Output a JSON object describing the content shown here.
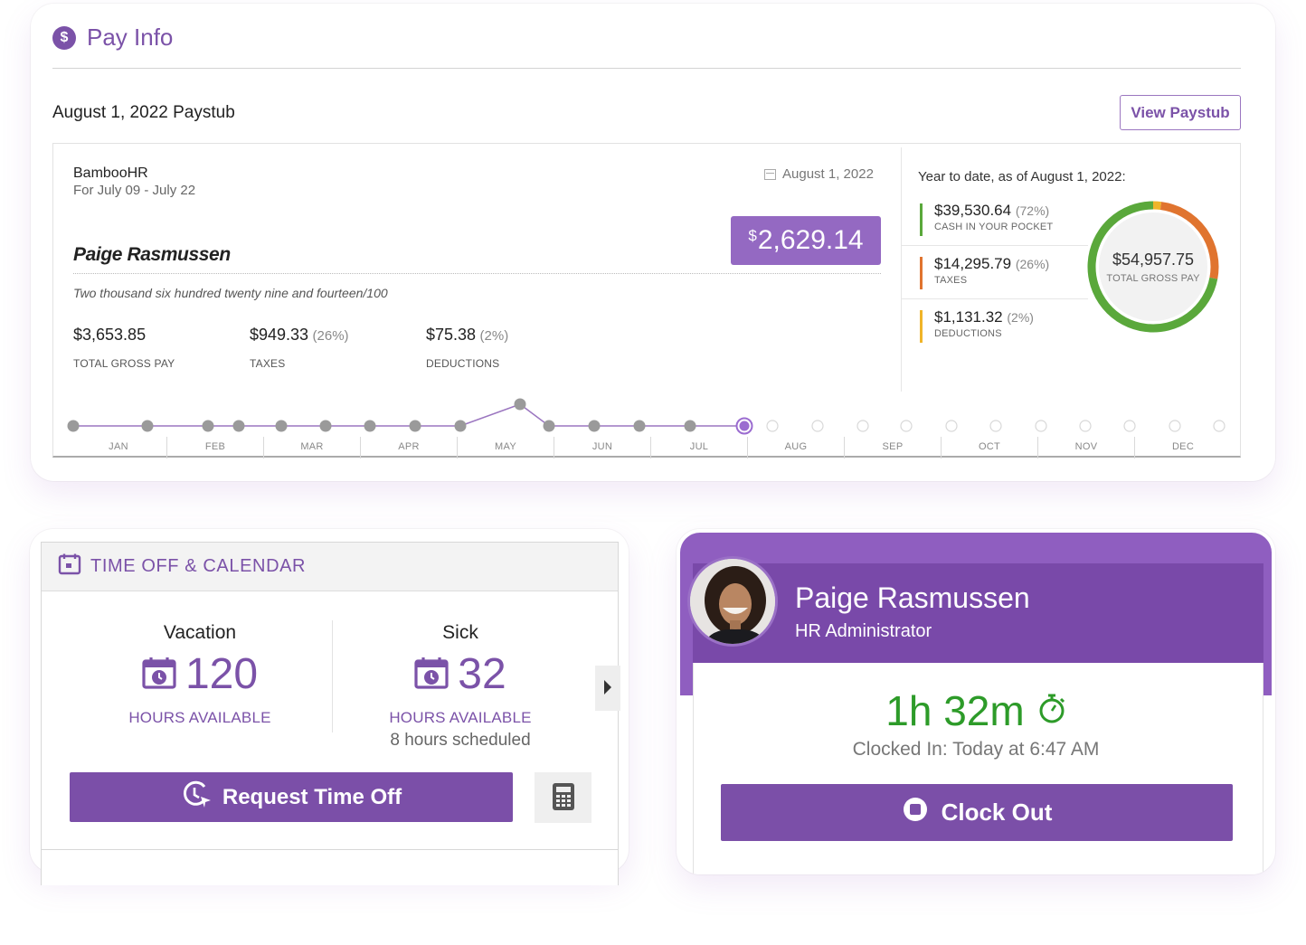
{
  "pay_info": {
    "title": "Pay Info",
    "paystub_title": "August 1, 2022 Paystub",
    "view_button": "View Paystub",
    "employer": "BambooHR",
    "period": "For July 09 - July 22",
    "date": "August 1, 2022",
    "net_currency": "$",
    "net_amount": "2,629.14",
    "employee": "Paige Rasmussen",
    "amount_words": "Two thousand six hundred twenty nine and fourteen/100",
    "stats": [
      {
        "amount": "$3,653.85",
        "pct": "",
        "label": "TOTAL GROSS PAY"
      },
      {
        "amount": "$949.33",
        "pct": "(26%)",
        "label": "TAXES"
      },
      {
        "amount": "$75.38",
        "pct": "(2%)",
        "label": "DEDUCTIONS"
      }
    ],
    "ytd": {
      "title": "Year to date, as of August 1, 2022:",
      "rows": [
        {
          "amount": "$39,530.64",
          "pct": "(72%)",
          "label": "CASH IN YOUR POCKET",
          "color": "#5aa83b"
        },
        {
          "amount": "$14,295.79",
          "pct": "(26%)",
          "label": "TAXES",
          "color": "#e0742f"
        },
        {
          "amount": "$1,131.32",
          "pct": "(2%)",
          "label": "DEDUCTIONS",
          "color": "#f0b429"
        }
      ],
      "total_amount": "$54,957.75",
      "total_label": "TOTAL GROSS PAY"
    },
    "donut_shares": [
      72,
      26,
      2
    ],
    "timeline": {
      "months": [
        "JAN",
        "FEB",
        "MAR",
        "APR",
        "MAY",
        "JUN",
        "JUL",
        "AUG",
        "SEP",
        "OCT",
        "NOV",
        "DEC"
      ],
      "colors": {
        "line": "#9b76c0",
        "point": "#9a9a9a",
        "current": "#9b6cd0",
        "future": "#d8d8d8"
      }
    }
  },
  "time_off": {
    "title": "TIME OFF & CALENDAR",
    "vacation": {
      "title": "Vacation",
      "hours": "120",
      "label": "HOURS AVAILABLE"
    },
    "sick": {
      "title": "Sick",
      "hours": "32",
      "label": "HOURS AVAILABLE",
      "scheduled": "8 hours scheduled"
    },
    "request_button": "Request Time Off",
    "icons": [
      "calendar-icon",
      "clock-arrow-icon",
      "calculator-icon",
      "chevron-right-icon"
    ]
  },
  "clock": {
    "name": "Paige Rasmussen",
    "role": "HR Administrator",
    "elapsed": "1h 32m",
    "clocked_in": "Clocked In: Today at 6:47 AM",
    "button": "Clock Out",
    "colors": {
      "accent": "#7b4fa8",
      "elapsed": "#2d9b29"
    }
  }
}
